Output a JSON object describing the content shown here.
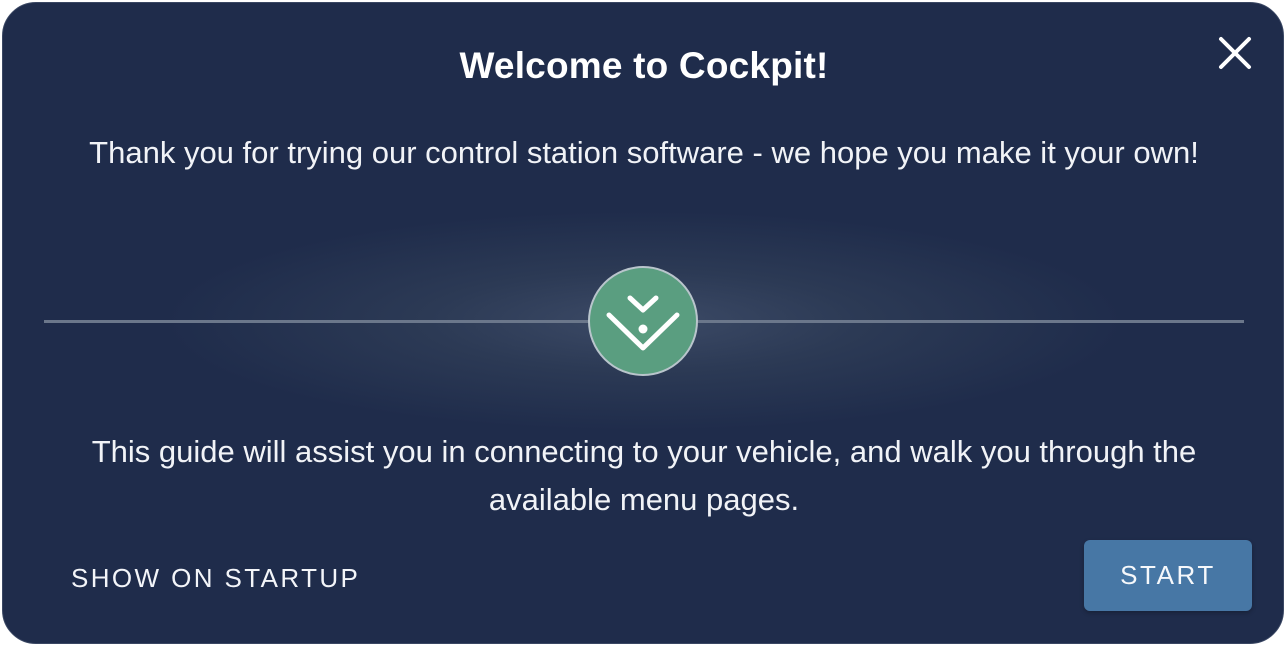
{
  "dialog": {
    "title": "Welcome to Cockpit!",
    "intro_text": "Thank you for trying our control station software - we hope you make it your own!",
    "guide_text": "This guide will assist you in connecting to your vehicle, and walk you through the available menu pages.",
    "show_on_startup_label": "SHOW ON STARTUP",
    "start_label": "START"
  },
  "icons": {
    "close": "close-icon",
    "logo": "cockpit-logo-icon"
  },
  "colors": {
    "background": "#1f2c4b",
    "logo_circle": "#5a9e80",
    "start_button": "#4777a5",
    "text": "#ffffff"
  }
}
